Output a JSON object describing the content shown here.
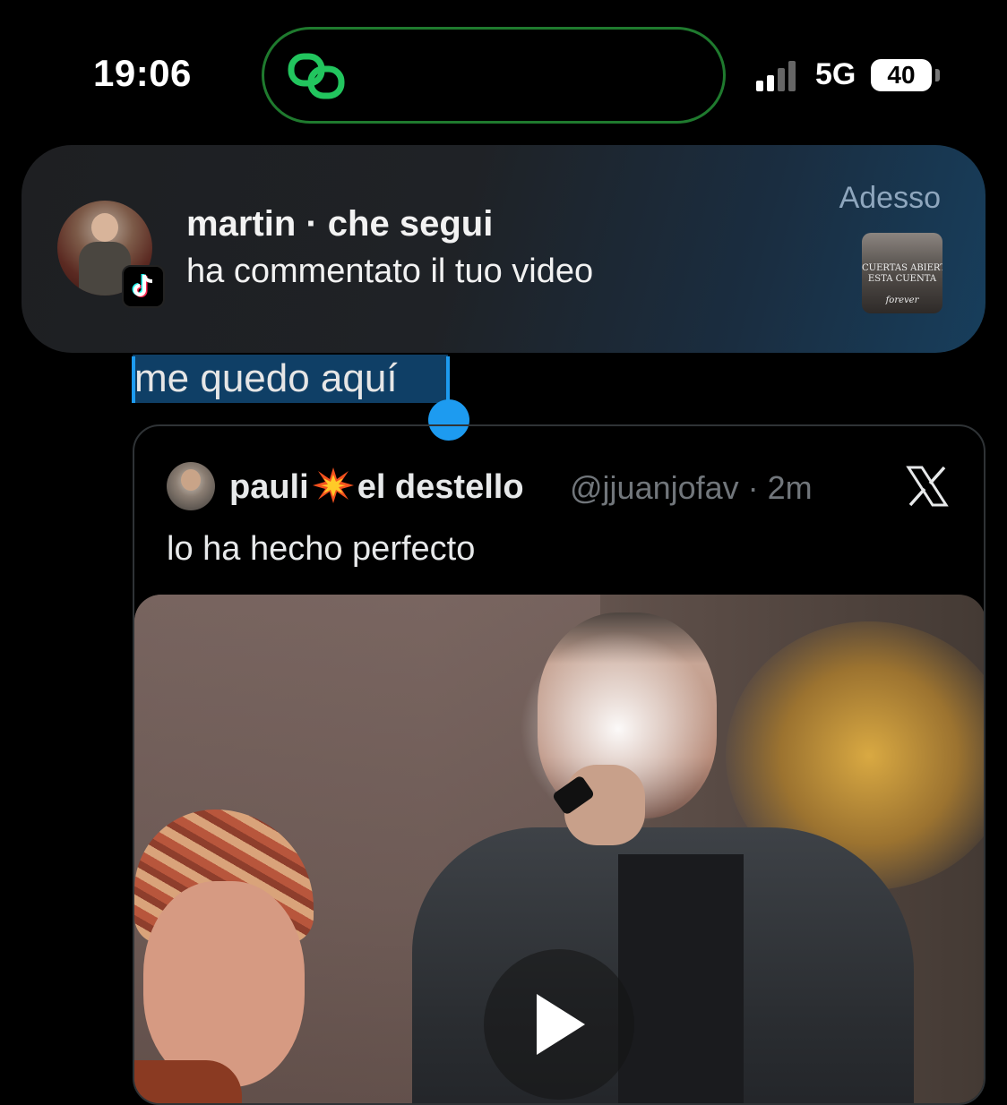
{
  "status_bar": {
    "time": "19:06",
    "network": "5G",
    "battery": "40",
    "island_icon": "link-chain-icon",
    "island_icon_color": "#22c55e"
  },
  "notification": {
    "app_icon": "tiktok-icon",
    "title": "martin · che segui",
    "body": "ha commentato il tuo video",
    "time": "Adesso",
    "thumbnail_lines": [
      "CUERTAS ABIERTAS A",
      "ESTA CUENTA",
      "forever"
    ]
  },
  "post": {
    "selected_text": "me quedo aquí",
    "selection_color": "#1d9bf0"
  },
  "quoted_tweet": {
    "name_part1": "pauli",
    "name_emoji": "collision-icon",
    "name_part2": "el destello",
    "handle": "@jjuanjofav",
    "time": "· 2m",
    "text": "lo ha hecho perfecto",
    "platform_icon": "x-logo-icon",
    "media_control": "play-icon"
  }
}
